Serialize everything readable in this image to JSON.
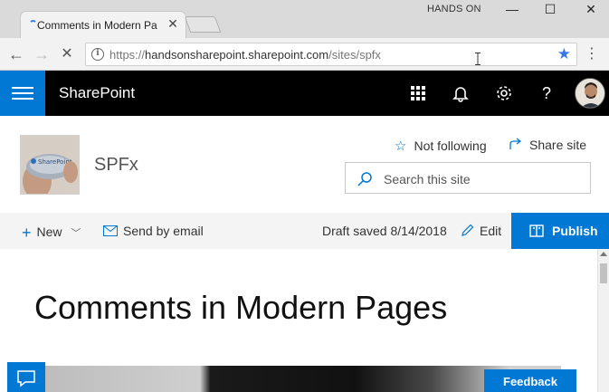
{
  "browser": {
    "tab_title": "Comments in Modern Pa",
    "profile": "HANDS ON",
    "url_scheme": "https://",
    "url_host": "handsonsharepoint.sharepoint.com",
    "url_path": "/sites/spfx"
  },
  "suitebar": {
    "brand": "SharePoint",
    "accent": "#0078d4"
  },
  "site": {
    "title": "SPFx",
    "follow_label": "Not following",
    "share_label": "Share site",
    "search_placeholder": "Search this site",
    "logo_text": "SharePoint"
  },
  "commandbar": {
    "new_label": "New",
    "send_label": "Send by email",
    "status": "Draft saved 8/14/2018",
    "edit_label": "Edit",
    "publish_label": "Publish"
  },
  "page": {
    "title": "Comments in Modern Pages"
  },
  "footer": {
    "feedback_label": "Feedback"
  }
}
